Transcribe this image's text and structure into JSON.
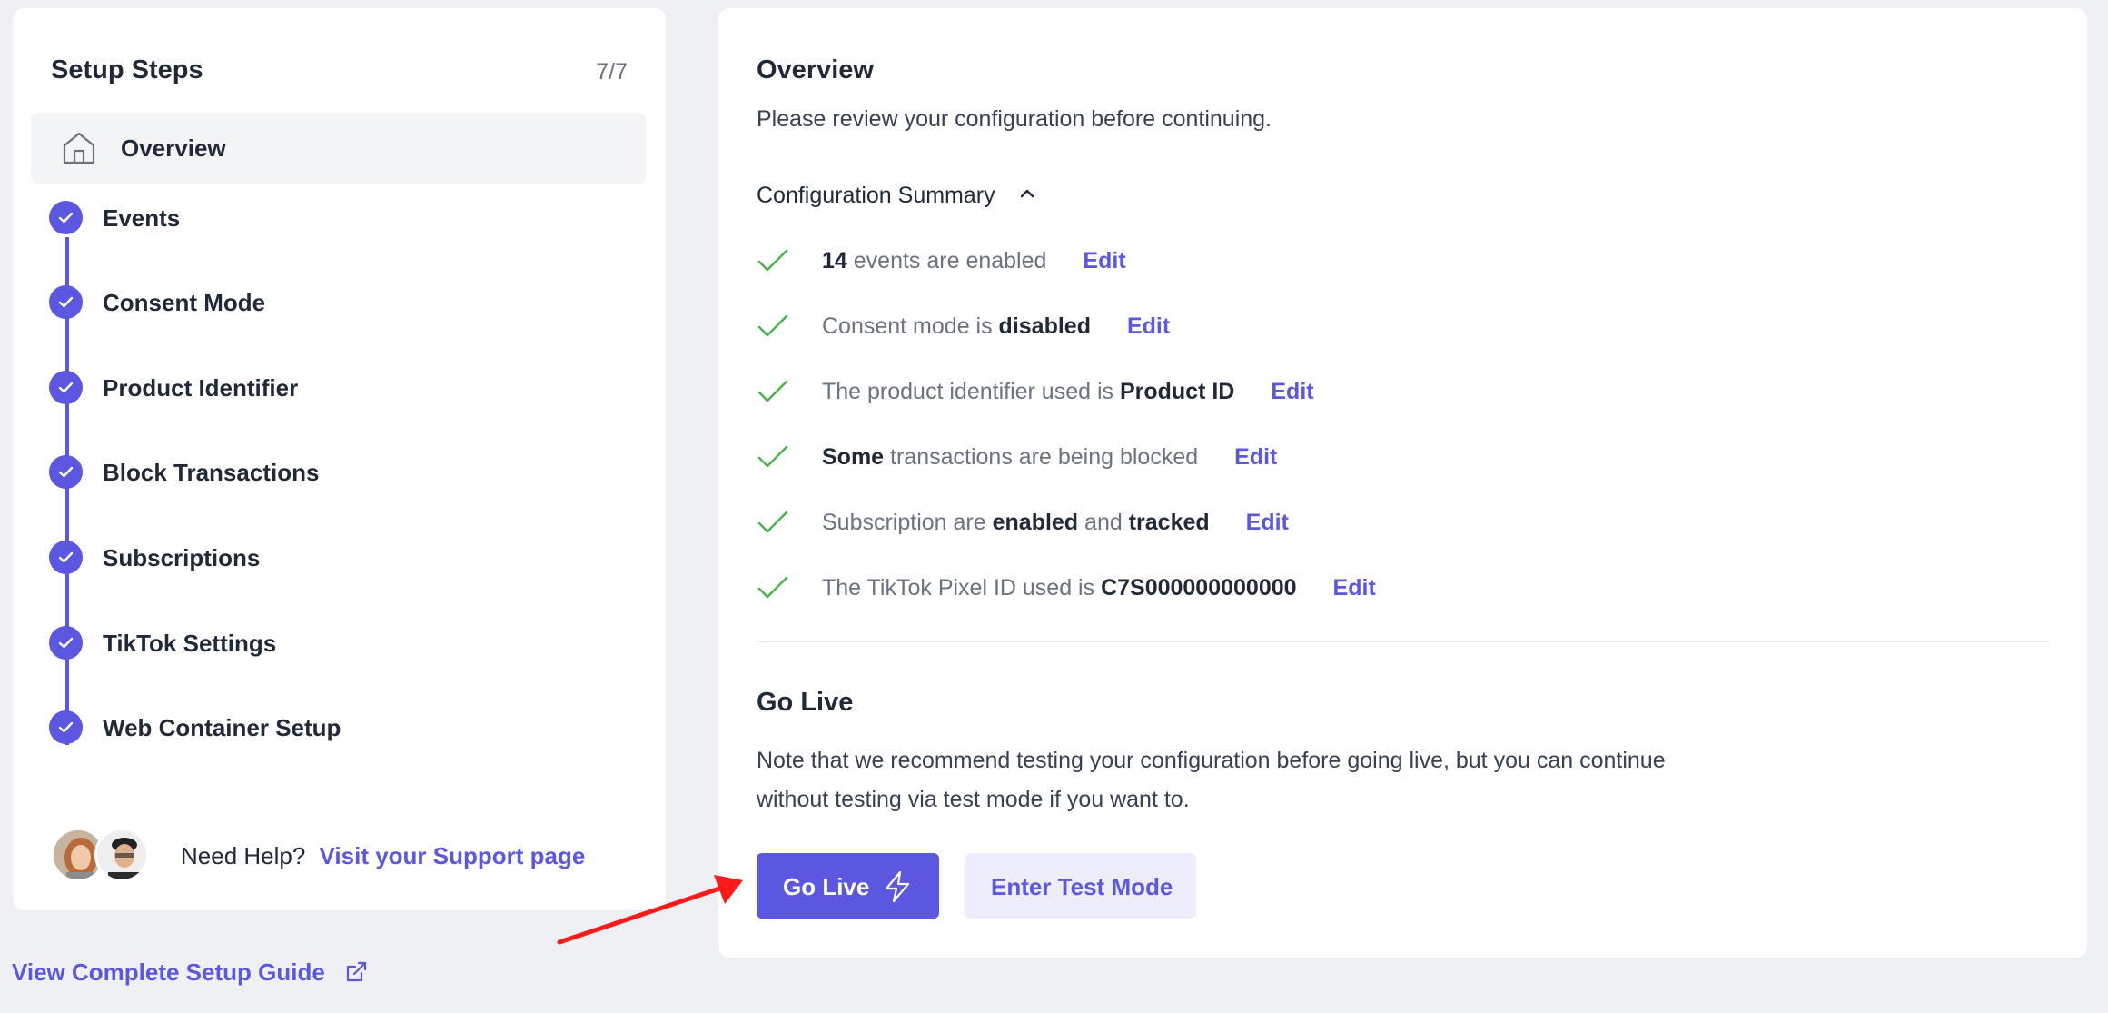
{
  "sidebar": {
    "title": "Setup Steps",
    "progress": "7/7",
    "overview_label": "Overview",
    "steps": [
      {
        "label": "Events"
      },
      {
        "label": "Consent Mode"
      },
      {
        "label": "Product Identifier"
      },
      {
        "label": "Block Transactions"
      },
      {
        "label": "Subscriptions"
      },
      {
        "label": "TikTok Settings"
      },
      {
        "label": "Web Container Setup"
      }
    ],
    "help": {
      "question": "Need Help?",
      "link": "Visit your Support page"
    },
    "guide_link": "View Complete Setup Guide"
  },
  "main": {
    "title": "Overview",
    "subtitle": "Please review your configuration before continuing.",
    "summary_toggle": "Configuration Summary",
    "summary": [
      {
        "parts": [
          {
            "t": "14",
            "b": true
          },
          {
            "t": " events are enabled"
          }
        ],
        "edit": "Edit"
      },
      {
        "parts": [
          {
            "t": "Consent mode is "
          },
          {
            "t": "disabled",
            "b": true
          }
        ],
        "edit": "Edit"
      },
      {
        "parts": [
          {
            "t": "The product identifier used is "
          },
          {
            "t": "Product ID",
            "b": true
          }
        ],
        "edit": "Edit"
      },
      {
        "parts": [
          {
            "t": "Some",
            "b": true
          },
          {
            "t": " transactions are being blocked"
          }
        ],
        "edit": "Edit"
      },
      {
        "parts": [
          {
            "t": "Subscription are "
          },
          {
            "t": "enabled",
            "b": true
          },
          {
            "t": " and "
          },
          {
            "t": "tracked",
            "b": true
          }
        ],
        "edit": "Edit"
      },
      {
        "parts": [
          {
            "t": "The TikTok Pixel ID used is "
          },
          {
            "t": "C7S000000000000",
            "b": true
          }
        ],
        "edit": "Edit"
      }
    ],
    "go_live": {
      "title": "Go Live",
      "note": "Note that we recommend testing your configuration before going live, but you can continue without testing via test mode if you want to.",
      "primary_button": "Go Live",
      "secondary_button": "Enter Test Mode"
    }
  },
  "colors": {
    "accent": "#5b57e0",
    "check": "#4caf50",
    "annotation_arrow": "#ff1a1a"
  }
}
